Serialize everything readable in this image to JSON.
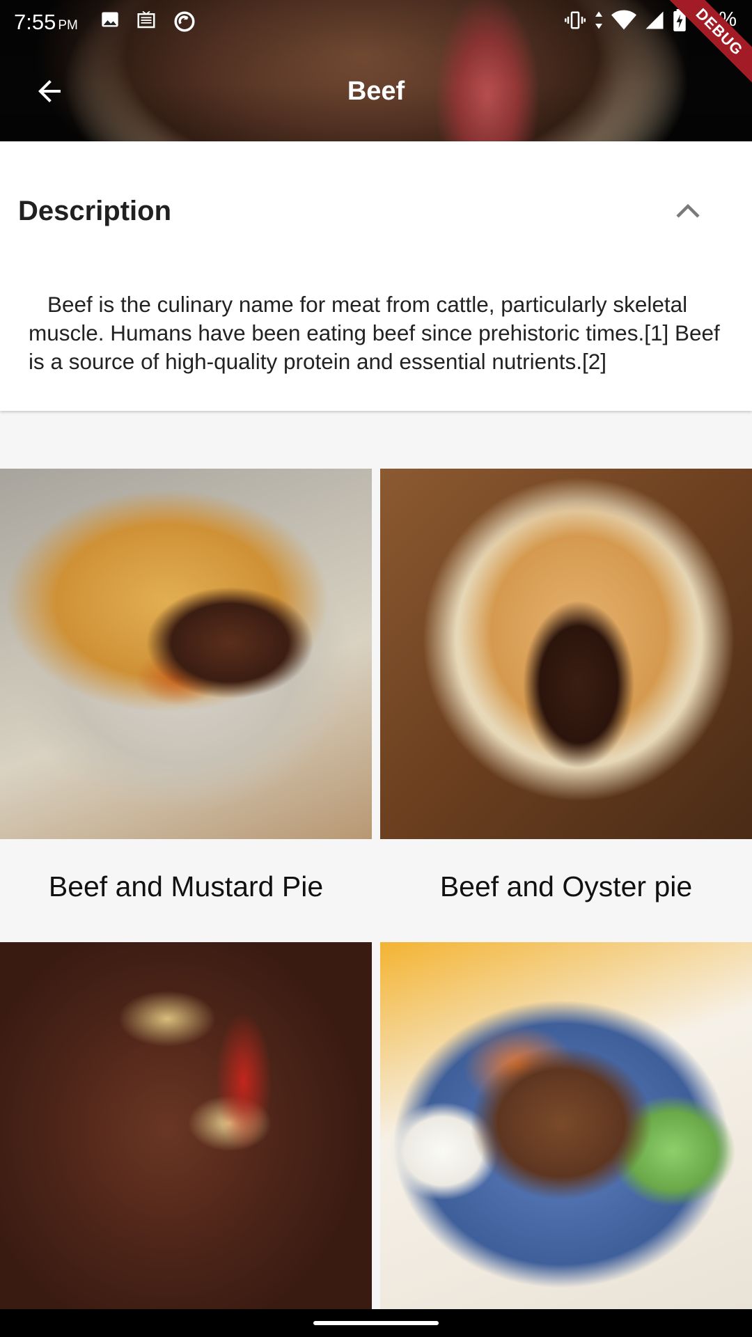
{
  "status_bar": {
    "time": "7:55",
    "ampm": "PM",
    "battery": "98%",
    "left_icons": [
      "image-icon",
      "news-icon",
      "sync-icon"
    ],
    "right_icons": [
      "vibrate-icon",
      "data-arrows-icon",
      "wifi-icon",
      "signal-icon",
      "battery-charging-icon"
    ],
    "debug_label": "DEBUG"
  },
  "app_bar": {
    "title": "Beef",
    "back_icon": "arrow-back-icon"
  },
  "description": {
    "heading": "Description",
    "toggle_icon": "chevron-up-icon",
    "text": "Beef is the culinary name for meat from cattle, particularly skeletal muscle. Humans have been eating beef since prehistoric times.[1] Beef is a source of high-quality protein and essential nutrients.[2]"
  },
  "meals": [
    {
      "name": "Beef and Mustard Pie"
    },
    {
      "name": "Beef and Oyster pie"
    },
    {
      "name": ""
    },
    {
      "name": ""
    }
  ],
  "colors": {
    "status_bar_text": "#ffffff",
    "debug_ribbon": "#a31b25",
    "card_bg": "#ffffff",
    "page_bg": "#f6f6f6"
  }
}
